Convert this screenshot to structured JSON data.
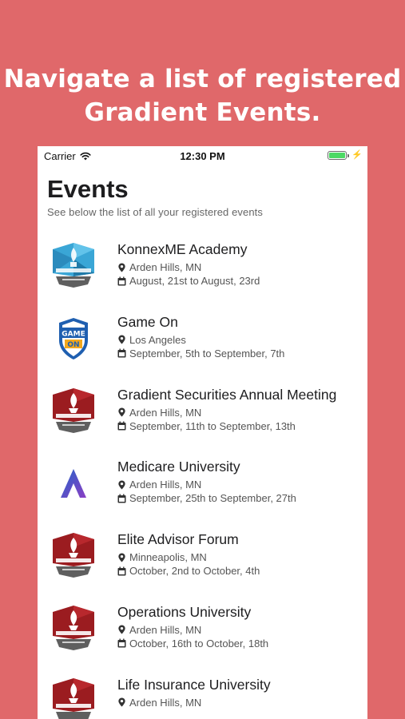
{
  "headline": {
    "line1": "Navigate a list of registered",
    "line2": "Gradient Events."
  },
  "status_bar": {
    "carrier": "Carrier",
    "time": "12:30 PM",
    "icons": [
      "wifi-icon",
      "battery-icon",
      "charging-bolt-icon"
    ]
  },
  "page": {
    "title": "Events",
    "subtitle": "See below the list of all your registered events"
  },
  "colors": {
    "background": "#e0686a",
    "badge_blue": "#3aa6d6",
    "badge_red": "#9b1c20",
    "badge_grey": "#5f5f5f",
    "medicare_blue": "#2563c9",
    "medicare_purple": "#8b3fc4"
  },
  "events": [
    {
      "title": "KonnexME Academy",
      "location": "Arden Hills, MN",
      "dates": "August, 21st to August, 23rd",
      "logo_icon": "konnexme-badge-icon"
    },
    {
      "title": "Game On",
      "location": "Los Angeles",
      "dates": "September, 5th to September, 7th",
      "logo_icon": "game-on-shield-icon",
      "logo_text_top": "GAME",
      "logo_text_bottom": "ON"
    },
    {
      "title": "Gradient Securities Annual Meeting",
      "location": "Arden Hills, MN",
      "dates": "September, 11th to September, 13th",
      "logo_icon": "securities-torch-badge-icon"
    },
    {
      "title": "Medicare University",
      "location": "Arden Hills, MN",
      "dates": "September, 25th to September, 27th",
      "logo_icon": "medicare-a-icon"
    },
    {
      "title": "Elite Advisor Forum",
      "location": "Minneapolis, MN",
      "dates": "October, 2nd to October, 4th",
      "logo_icon": "elite-advisor-torch-badge-icon"
    },
    {
      "title": "Operations University",
      "location": "Arden Hills, MN",
      "dates": "October, 16th to October, 18th",
      "logo_icon": "operations-torch-badge-icon"
    },
    {
      "title": "Life Insurance University",
      "location": "Arden Hills, MN",
      "dates": "",
      "logo_icon": "life-insurance-torch-badge-icon"
    }
  ]
}
